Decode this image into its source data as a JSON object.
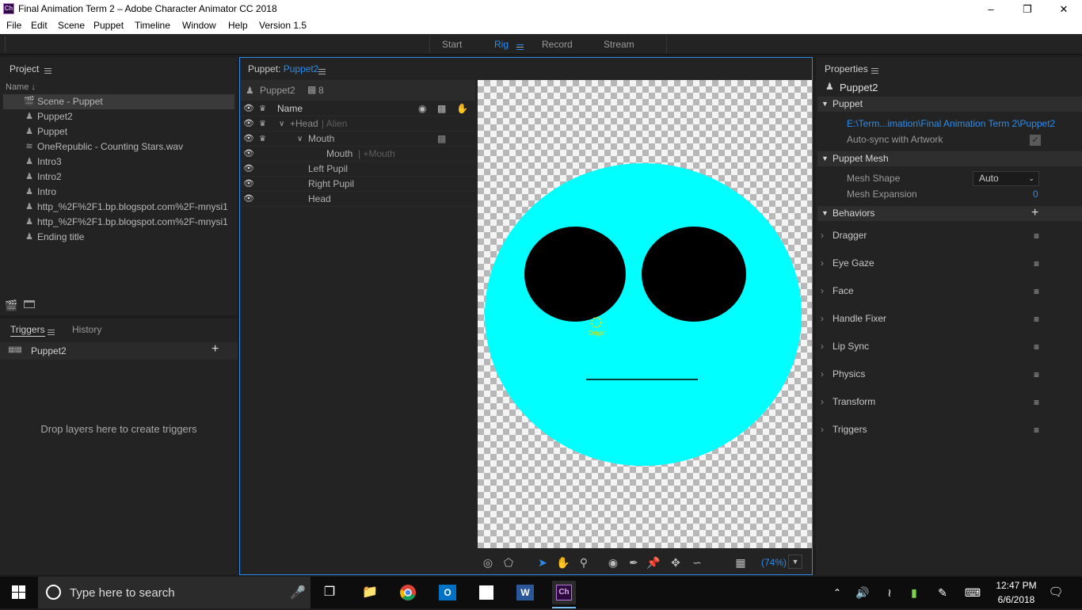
{
  "window": {
    "title": "Final Animation Term 2 – Adobe Character Animator CC 2018",
    "app_icon": "Ch"
  },
  "menu": [
    "File",
    "Edit",
    "Scene",
    "Puppet",
    "Timeline",
    "Window",
    "Help",
    "Version 1.5"
  ],
  "workspace_tabs": [
    "Start",
    "Rig",
    "Record",
    "Stream"
  ],
  "project": {
    "header": "Project",
    "sort_label": "Name",
    "items": [
      {
        "icon": "scene-icon",
        "label": "Scene - Puppet"
      },
      {
        "icon": "puppet-icon",
        "label": "Puppet2"
      },
      {
        "icon": "puppet-icon",
        "label": "Puppet"
      },
      {
        "icon": "audio-icon",
        "label": "OneRepublic - Counting Stars.wav"
      },
      {
        "icon": "puppet-icon",
        "label": "Intro3"
      },
      {
        "icon": "puppet-icon",
        "label": "Intro2"
      },
      {
        "icon": "puppet-icon",
        "label": "Intro"
      },
      {
        "icon": "puppet-icon",
        "label": "http_%2F%2F1.bp.blogspot.com%2F-mnysi1S..."
      },
      {
        "icon": "puppet-icon",
        "label": "http_%2F%2F1.bp.blogspot.com%2F-mnysi1S..."
      },
      {
        "icon": "puppet-icon",
        "label": "Ending title"
      }
    ]
  },
  "triggers": {
    "tab_triggers": "Triggers",
    "tab_history": "History",
    "puppet": "Puppet2",
    "empty_text": "Drop layers here to create triggers"
  },
  "puppet_panel": {
    "header_prefix": "Puppet:",
    "header_name": "Puppet2",
    "puppet_name": "Puppet2",
    "layer_count": "8",
    "name_col": "Name",
    "layers": [
      {
        "name": "+Head",
        "alias": "Alien",
        "indent": 1,
        "expanded": true
      },
      {
        "name": "Mouth",
        "alias": "",
        "indent": 2,
        "expanded": true
      },
      {
        "name": "Mouth",
        "alias": "+Mouth",
        "indent": 3,
        "expanded": false
      },
      {
        "name": "Left Pupil",
        "alias": "",
        "indent": 2,
        "expanded": false
      },
      {
        "name": "Right Pupil",
        "alias": "",
        "indent": 2,
        "expanded": false
      },
      {
        "name": "Head",
        "alias": "",
        "indent": 2,
        "expanded": false
      }
    ]
  },
  "canvas": {
    "origin_label": "Origin",
    "zoom": "(74%)",
    "face_color": "#00ffff"
  },
  "properties": {
    "header": "Properties",
    "puppet_name": "Puppet2",
    "section_puppet": "Puppet",
    "path": "E:\\Term...imation\\Final Animation Term 2\\Puppet2",
    "autosync": "Auto-sync with Artwork",
    "section_mesh": "Puppet Mesh",
    "mesh_shape_label": "Mesh Shape",
    "mesh_shape_value": "Auto",
    "mesh_expansion_label": "Mesh Expansion",
    "mesh_expansion_value": "0",
    "section_behaviors": "Behaviors",
    "behaviors": [
      "Dragger",
      "Eye Gaze",
      "Face",
      "Handle Fixer",
      "Lip Sync",
      "Physics",
      "Transform",
      "Triggers"
    ]
  },
  "taskbar": {
    "search_placeholder": "Type here to search",
    "time": "12:47 PM",
    "date": "6/6/2018"
  },
  "colors": {
    "accent": "#2d8ceb",
    "panel": "#232323",
    "selected_row": "#3a3a3a"
  }
}
